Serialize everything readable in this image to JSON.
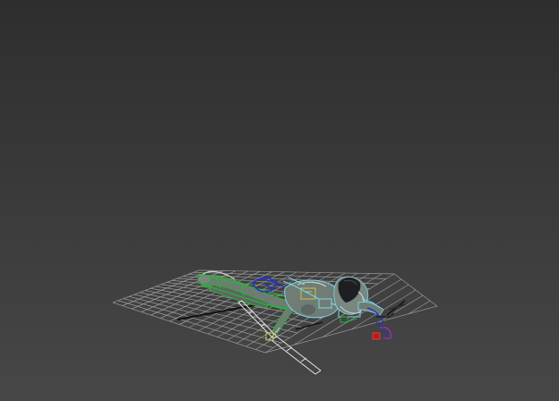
{
  "viewport": {
    "background_top": "#2e2e2e",
    "background_bottom": "#474747",
    "grid_color": "#9a9a9a"
  },
  "model": {
    "skin_color": "#6f7b74",
    "skin_highlight": "#c9d2cc",
    "hair_color": "#1e1f22",
    "biped_green": "#2fae3c",
    "biped_blue": "#2233cc",
    "biped_cyan": "#7fd7e6",
    "biped_red": "#c01818",
    "biped_magenta": "#a030c0",
    "bone_white": "#e6e6e6",
    "shadow_color": "#111111"
  }
}
